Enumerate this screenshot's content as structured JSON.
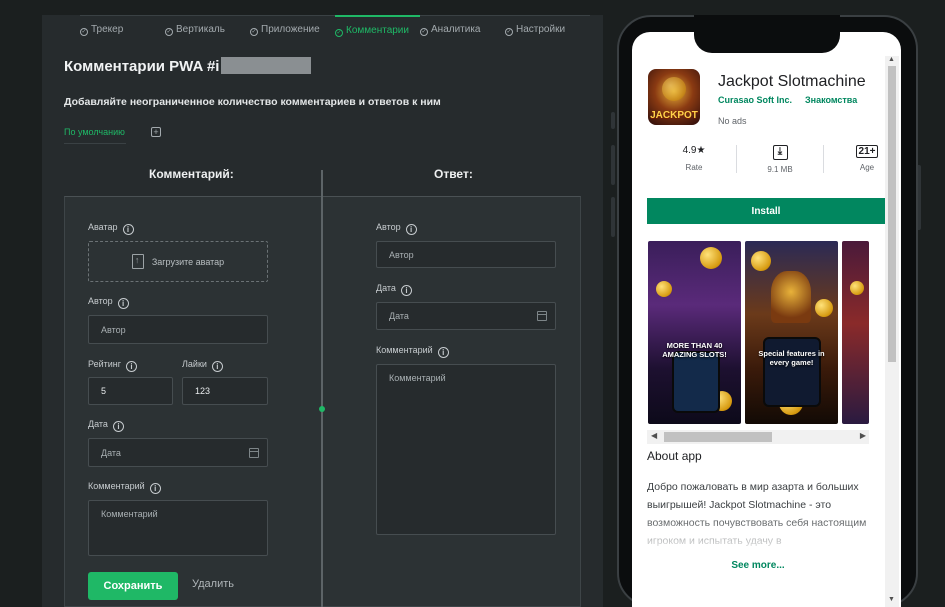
{
  "nav_tabs": [
    {
      "label": "Трекер",
      "active": false
    },
    {
      "label": "Вертикаль",
      "active": false
    },
    {
      "label": "Приложение",
      "active": false
    },
    {
      "label": "Комментарии",
      "active": true
    },
    {
      "label": "Аналитика",
      "active": false
    },
    {
      "label": "Настройки",
      "active": false
    }
  ],
  "page": {
    "title": "Комментарии PWA #i",
    "subtitle": "Добавляйте неограниченное количество комментариев и ответов к ним",
    "default_tab": "По умолчанию",
    "add_tab_symbol": "+"
  },
  "comment_form": {
    "heading": "Комментарий:",
    "avatar_label": "Аватар",
    "upload_text": "Загрузите аватар",
    "author_label": "Автор",
    "author_placeholder": "Автор",
    "rating_label": "Рейтинг",
    "rating_value": "5",
    "likes_label": "Лайки",
    "likes_value": "123",
    "date_label": "Дата",
    "date_placeholder": "Дата",
    "comment_label": "Комментарий",
    "comment_placeholder": "Комментарий",
    "save_label": "Сохранить",
    "delete_label": "Удалить"
  },
  "reply_form": {
    "heading": "Ответ:",
    "author_label": "Автор",
    "author_placeholder": "Автор",
    "date_label": "Дата",
    "date_placeholder": "Дата",
    "comment_label": "Комментарий",
    "comment_placeholder": "Комментарий"
  },
  "info_symbol": "i",
  "preview": {
    "app_name": "Jackpot Slotmachine",
    "developer": "Curasao Soft Inc.",
    "category": "Знакомства",
    "ads": "No ads",
    "icon_text": "JACKPOT",
    "rating": "4.9★",
    "rating_label": "Rate",
    "size": "9.1 MB",
    "age": "21+",
    "age_label": "Age",
    "install_label": "Install",
    "screenshot_captions": [
      "MORE THAN 40 AMAZING SLOTS!",
      "Special features in every game!"
    ],
    "about_title": "About app",
    "description": "Добро пожаловать в мир азарта и больших выигрышей! Jackpot Slotmachine - это возможность почувствовать себя настоящим игроком и испытать удачу в",
    "see_more": "See more...",
    "accent_color": "#01875f"
  },
  "colors": {
    "brand_green": "#1fb866",
    "panel_bg": "#262b2d",
    "page_bg": "#1b1f1f"
  }
}
